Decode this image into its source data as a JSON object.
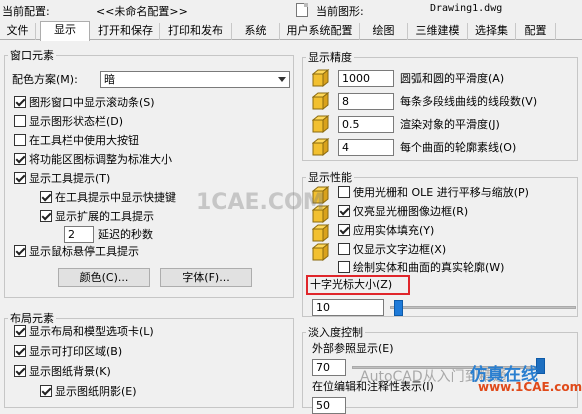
{
  "topbar": {
    "current_config_label": "当前配置:",
    "current_config_value": "<<未命名配置>>",
    "current_drawing_label": "当前图形:",
    "current_drawing_value": "Drawing1.dwg"
  },
  "tabs": [
    {
      "label": "文件"
    },
    {
      "label": "显示"
    },
    {
      "label": "打开和保存"
    },
    {
      "label": "打印和发布"
    },
    {
      "label": "系统"
    },
    {
      "label": "用户系统配置"
    },
    {
      "label": "绘图"
    },
    {
      "label": "三维建模"
    },
    {
      "label": "选择集"
    },
    {
      "label": "配置"
    }
  ],
  "window_elements": {
    "title": "窗口元素",
    "color_scheme_label": "配色方案(M):",
    "color_scheme_value": "暗",
    "items": [
      {
        "label": "图形窗口中显示滚动条(S)",
        "checked": true
      },
      {
        "label": "显示图形状态栏(D)",
        "checked": false
      },
      {
        "label": "在工具栏中使用大按钮",
        "checked": false
      },
      {
        "label": "将功能区图标调整为标准大小",
        "checked": true
      },
      {
        "label": "显示工具提示(T)",
        "checked": true
      },
      {
        "label": "在工具提示中显示快捷键",
        "checked": true
      },
      {
        "label": "显示扩展的工具提示",
        "checked": true
      }
    ],
    "delay_value": "2",
    "delay_label": "延迟的秒数",
    "hover_tooltip": {
      "label": "显示鼠标悬停工具提示",
      "checked": true
    },
    "colors_button": "颜色(C)...",
    "fonts_button": "字体(F)..."
  },
  "layout_elements": {
    "title": "布局元素",
    "items": [
      {
        "label": "显示布局和模型选项卡(L)",
        "checked": true
      },
      {
        "label": "显示可打印区域(B)",
        "checked": true
      },
      {
        "label": "显示图纸背景(K)",
        "checked": true
      },
      {
        "label": "显示图纸阴影(E)",
        "checked": true
      }
    ]
  },
  "display_resolution": {
    "title": "显示精度",
    "items": [
      {
        "value": "1000",
        "label": "圆弧和圆的平滑度(A)"
      },
      {
        "value": "8",
        "label": "每条多段线曲线的线段数(V)"
      },
      {
        "value": "0.5",
        "label": "渲染对象的平滑度(J)"
      },
      {
        "value": "4",
        "label": "每个曲面的轮廓素线(O)"
      }
    ]
  },
  "display_performance": {
    "title": "显示性能",
    "items": [
      {
        "label": "使用光栅和 OLE 进行平移与缩放(P)",
        "checked": false
      },
      {
        "label": "仅亮显光栅图像边框(R)",
        "checked": true
      },
      {
        "label": "应用实体填充(Y)",
        "checked": true
      },
      {
        "label": "仅显示文字边框(X)",
        "checked": false
      },
      {
        "label": "绘制实体和曲面的真实轮廓(W)",
        "checked": false
      }
    ]
  },
  "crosshair": {
    "label": "十字光标大小(Z)",
    "value": "10",
    "slider_fraction": 0.1
  },
  "fade_control": {
    "title": "淡入度控制",
    "xref_label": "外部参照显示(E)",
    "xref_value": "70",
    "inplace_label": "在位编辑和注释性表示(I)",
    "inplace_value": "50"
  },
  "watermarks": {
    "center": "1CAE.COM",
    "bottom_left": "AutoCAD从入门到精通",
    "bottom_right_cn": "仿真在线",
    "bottom_right_url": "www.1CAE.com"
  },
  "colors": {
    "highlight_red": "#e0262b",
    "accent_blue": "#1e7ad8"
  }
}
